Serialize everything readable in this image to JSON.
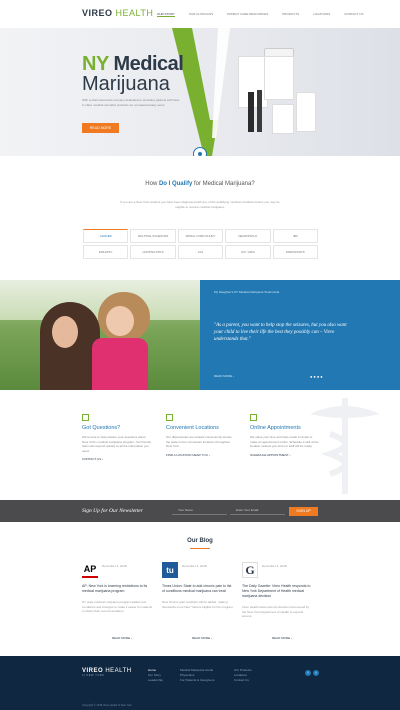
{
  "brand": {
    "vireo": "VIREO",
    "health": "HEALTH",
    "footer_vireo": "VIREO",
    "footer_health": "HEALTH",
    "footer_sub": "of NEW YORK"
  },
  "nav": [
    "Our Story",
    "Our Clinicians",
    "Patient Care Resources",
    "Products",
    "Locations",
    "Contact Us"
  ],
  "hero": {
    "title_ny": "NY",
    "title_rest": " Medical",
    "title_line2": "Marijuana",
    "desc": "With a pharmaceutical company dedicated to providing patients with best-in-class medical cannabis products we compassionately serve.",
    "button": "Read More"
  },
  "qualify": {
    "title_pre": "How ",
    "title_bold": "Do I Qualify",
    "title_post": " for Medical Marijuana?",
    "desc": "If you are a New York resident you have been diagnosed with any of the qualifying medical conditions below you may be eligible to receive medical marijuana.",
    "conditions": [
      "Cancer",
      "Multiple Sclerosis",
      "Spinal Cord Injury",
      "Neuropathy",
      "IBD",
      "Epilepsy",
      "Huntington's",
      "ALS",
      "HIV / AIDS",
      "Parkinson's"
    ]
  },
  "testimonial": {
    "heading": "My Daughter's NY Medical Marijuana Testimonial",
    "quote": "\"As a parent, you want to help stop the seizures, but you also want your child to live their life the best they possibly can – Vireo understands that.\"",
    "more": "Read More ›",
    "dots": "●●●●"
  },
  "features": [
    {
      "title": "Got Questions?",
      "desc": "We're here to help answer your questions about New York's medical marijuana program. Our friendly team will respond quickly to all the information you need.",
      "link": "Contact Us ›"
    },
    {
      "title": "Convenient Locations",
      "desc": "Our dispensaries are located conveniently across the state in four convenient locations throughout New York.",
      "link": "Find a Location Near You ›"
    },
    {
      "title": "Online Appointments",
      "desc": "We value your time and have made it simple to make an appointment online. Schedule a visit at the location nearest you and our staff will be ready.",
      "link": "Schedule Appointment ›"
    }
  ],
  "newsletter": {
    "title": "Sign Up for Our Newsletter",
    "name_placeholder": "Your Name",
    "email_placeholder": "Enter Your Email",
    "button": "Sign Up"
  },
  "blog": {
    "title": "Our Blog",
    "posts": [
      {
        "logo": "AP",
        "date": "December 4, 2018",
        "title": "AP: New York is lowering restrictions to its medical marijuana program",
        "desc": "NY state medical marijuana program added new conditions and changes to make it easier for patients to obtain their recommendation.",
        "more": "Read More ›"
      },
      {
        "logo": "tu",
        "date": "December 4, 2018",
        "title": "Times Union: State to add chronic pain to list of conditions medical marijuana can treat",
        "desc": "New chronic pain condition will be added, making thousands more New Yorkers eligible for the program.",
        "more": "Read More ›"
      },
      {
        "logo": "G",
        "date": "December 4, 2018",
        "title": "The Daily Gazette: Vireo Health responds to New York Department of Health medical marijuana decision",
        "desc": "Vireo Health welcomes the decision announced by the New York Department of Health to expand access.",
        "more": "Read More ›"
      }
    ]
  },
  "footer": {
    "col1": [
      "Home",
      "Our Story",
      "Leadership"
    ],
    "col2": [
      "Medical Marijuana Guide",
      "Physicians",
      "For Patients & Caregivers"
    ],
    "col3": [
      "Our Products",
      "Locations",
      "Contact Us"
    ],
    "copy": "Copyright © 2018 Vireo Health of New York"
  },
  "colors": {
    "accent": "#7ab030",
    "blue": "#2278b3",
    "orange": "#ef7a21",
    "navy": "#0f2740"
  }
}
